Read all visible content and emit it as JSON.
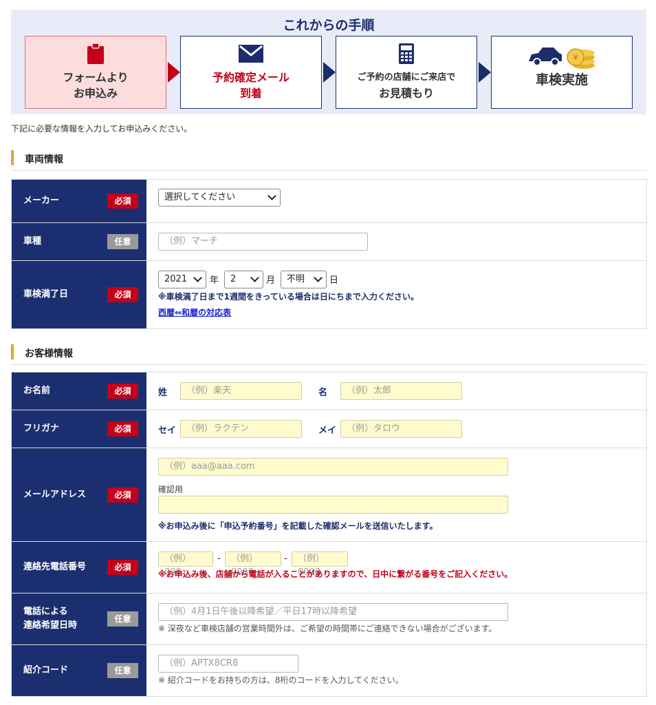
{
  "steps": {
    "title": "これからの手順",
    "items": [
      {
        "line1": "フォームより",
        "line2": "お申込み"
      },
      {
        "line1": "予約確定メール",
        "line2": "到着"
      },
      {
        "line1": "ご予約の店舗にご来店で",
        "line2": "お見積もり"
      },
      {
        "line1": "車検実施",
        "line2": ""
      }
    ]
  },
  "intro": "下記に必要な情報を入力してお申込みください。",
  "vehicle": {
    "heading": "車両情報",
    "maker": {
      "label": "メーカー",
      "tag": "必須",
      "select": "選択してください"
    },
    "model": {
      "label": "車種",
      "tag": "任意",
      "placeholder": "（例）マーチ"
    },
    "expiry": {
      "label": "車検満了日",
      "tag": "必須",
      "year": "2021",
      "year_unit": "年",
      "month": "2",
      "month_unit": "月",
      "day": "不明",
      "day_unit": "日",
      "note": "※車検満了日まで1週間をきっている場合は日にちまで入力ください。",
      "link": "西暦⇔和暦の対応表"
    }
  },
  "customer": {
    "heading": "お客様情報",
    "name": {
      "label": "お名前",
      "tag": "必須",
      "last_label": "姓",
      "last_placeholder": "（例）楽天",
      "first_label": "名",
      "first_placeholder": "（例）太郎"
    },
    "kana": {
      "label": "フリガナ",
      "tag": "必須",
      "last_label": "セイ",
      "last_placeholder": "（例）ラクテン",
      "first_label": "メイ",
      "first_placeholder": "（例）タロウ"
    },
    "email": {
      "label": "メールアドレス",
      "tag": "必須",
      "placeholder": "（例）aaa@aaa.com",
      "confirm_label": "確認用",
      "confirm_placeholder": "",
      "note": "※お申込み後に「申込予約番号」を記載した確認メールを送信いたします。"
    },
    "phone": {
      "label": "連絡先電話番号",
      "tag": "必須",
      "p1": "（例）000",
      "sep1": "-",
      "p2": "（例）0000",
      "sep2": "-",
      "p3": "（例）0000",
      "note": "※お申込み後、店舗から電話が入ることがありますので、日中に繋がる番号をご記入ください。"
    },
    "contact_time": {
      "label_line1": "電話による",
      "label_line2": "連絡希望日時",
      "tag": "任意",
      "placeholder": "（例）4月1日午後以降希望／平日17時以降希望",
      "note": "※ 深夜など車検店舗の営業時間外は、ご希望の時間帯にご連絡できない場合がございます。"
    },
    "referral": {
      "label": "紹介コード",
      "tag": "任意",
      "placeholder": "（例）APTX8CR8",
      "note": "※ 紹介コードをお持ちの方は、8桁のコードを入力してください。"
    }
  },
  "colors": {
    "navy": "#1b2f70",
    "required": "#c40018",
    "optional": "#9a9a9a",
    "accent": "#e0a72a",
    "input_yellow": "#fffbcf"
  }
}
